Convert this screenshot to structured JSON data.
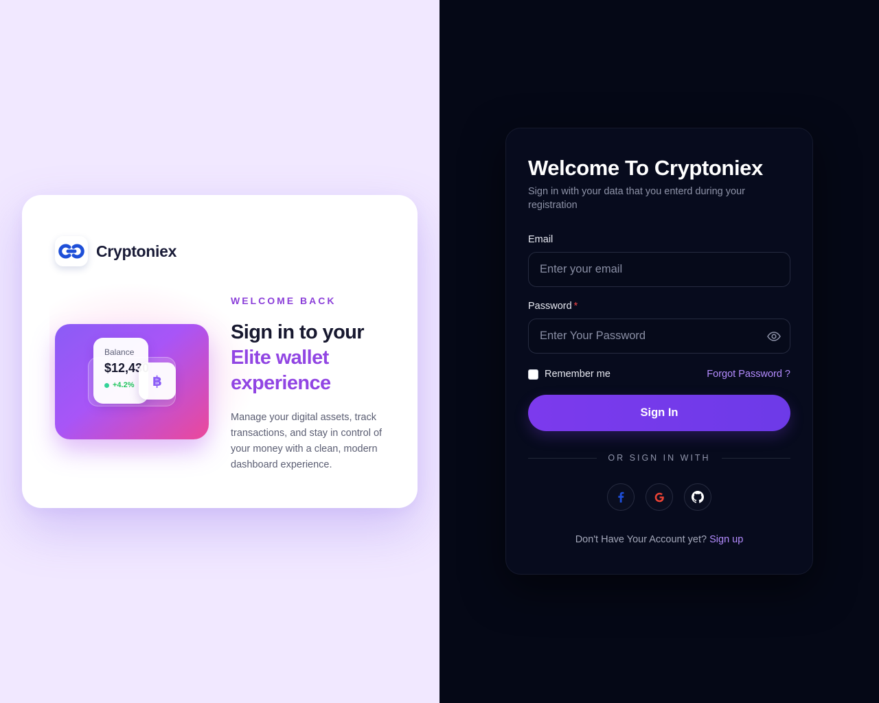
{
  "brand": {
    "name": "Cryptoniex",
    "logo_icon": "linked-arrows-logo-icon",
    "logo_color": "#1e4fd8"
  },
  "promo": {
    "eyebrow": "WELCOME BACK",
    "headline_line1": "Sign in to your",
    "headline_line2": "Elite wallet",
    "headline_line3": "experience",
    "description": "Manage your digital assets, track transactions, and stay in control of your money with a clean, modern dashboard experience.",
    "illustration": {
      "balance_label": "Balance",
      "balance_value": "$12,430",
      "balance_change": "+4.2%",
      "coin_icon": "bitcoin-icon",
      "coin_symbol": "฿"
    }
  },
  "login": {
    "title": "Welcome To Cryptoniex",
    "subtitle": "Sign in with your data that you enterd during your registration",
    "email_label": "Email",
    "email_placeholder": "Enter your email",
    "password_label": "Password",
    "password_required_mark": "*",
    "password_placeholder": "Enter Your Password",
    "remember_label": "Remember me",
    "forgot_label": "Forgot Password ?",
    "signin_label": "Sign In",
    "divider_text": "OR SIGN IN WITH",
    "socials": [
      {
        "name": "facebook",
        "icon": "facebook-icon",
        "glyph": "f",
        "color": "#1d4ed8"
      },
      {
        "name": "google",
        "icon": "google-icon",
        "glyph": "G",
        "color": "#ea4335"
      },
      {
        "name": "github",
        "icon": "github-icon",
        "color": "#ffffff"
      }
    ],
    "signup_prompt": "Don't Have Your Account yet?",
    "signup_link": "Sign up"
  },
  "colors": {
    "left_bg": "#f1e8ff",
    "right_bg": "#050816",
    "accent": "#7c3aed",
    "link": "#b48cff"
  }
}
